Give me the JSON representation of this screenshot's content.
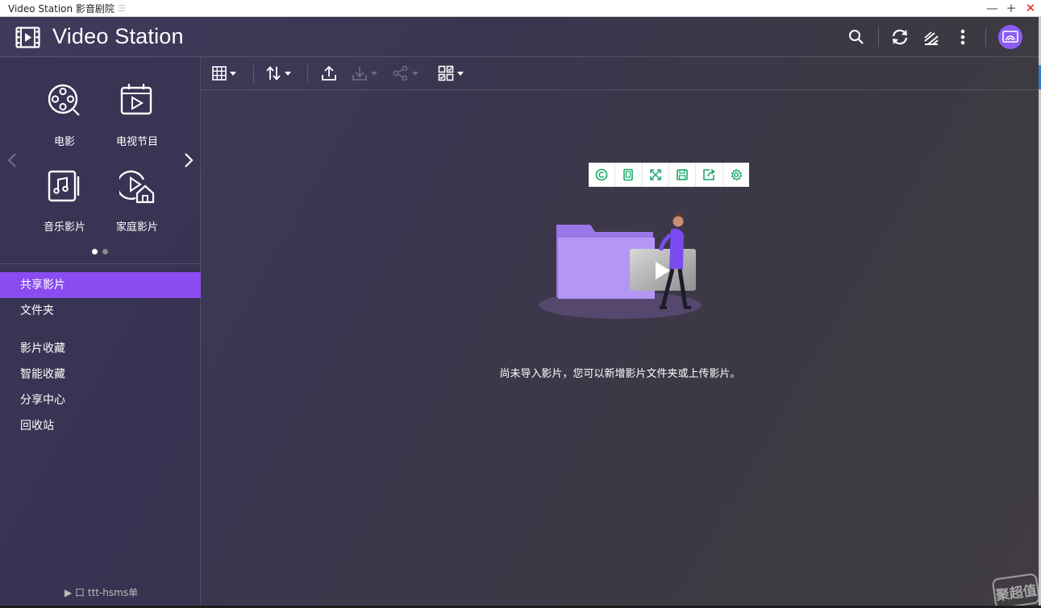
{
  "window": {
    "title": "Video Station 影音剧院",
    "title_mark": "☰",
    "minimize_glyph": "—",
    "maximize_glyph": "+",
    "close_glyph": "✕"
  },
  "header": {
    "app_name": "Video Station",
    "icons": [
      "film-icon",
      "search-icon",
      "refresh-icon",
      "background-tasks-icon",
      "more-icon",
      "cast-icon"
    ]
  },
  "sidebar": {
    "categories": [
      {
        "label": "电影",
        "icon": "movie-reel-icon"
      },
      {
        "label": "电视节目",
        "icon": "tv-show-icon"
      },
      {
        "label": "音乐影片",
        "icon": "music-video-icon"
      },
      {
        "label": "家庭影片",
        "icon": "home-video-icon"
      }
    ],
    "items": [
      {
        "label": "共享影片",
        "active": true
      },
      {
        "label": "文件夹",
        "active": false
      },
      {
        "label": "影片收藏",
        "active": false
      },
      {
        "label": "智能收藏",
        "active": false
      },
      {
        "label": "分享中心",
        "active": false
      },
      {
        "label": "回收站",
        "active": false
      }
    ]
  },
  "toolbar": {
    "buttons": [
      "grid-view-icon",
      "sort-icon",
      "upload-icon",
      "download-icon",
      "share-icon",
      "select-mode-icon"
    ]
  },
  "empty_state": {
    "message_prefix": "尚未导入影片，您可以",
    "link_new_folder": "新增影片文件夹",
    "connector": "或",
    "link_upload": "上传影片",
    "suffix": "。"
  },
  "overlay_toolbar": {
    "icons": [
      "capture-icon",
      "window-icon",
      "fullscreen-icon",
      "save-icon",
      "export-icon",
      "settings-icon"
    ]
  },
  "watermark": {
    "text": "聚超值"
  },
  "colors": {
    "accent": "#8a4cf0",
    "link": "#3aa0ff",
    "overlay_icon": "#1aa86a",
    "close": "#e02020"
  },
  "underlay": {
    "text": "▶ 口 ttt-hsms单"
  }
}
